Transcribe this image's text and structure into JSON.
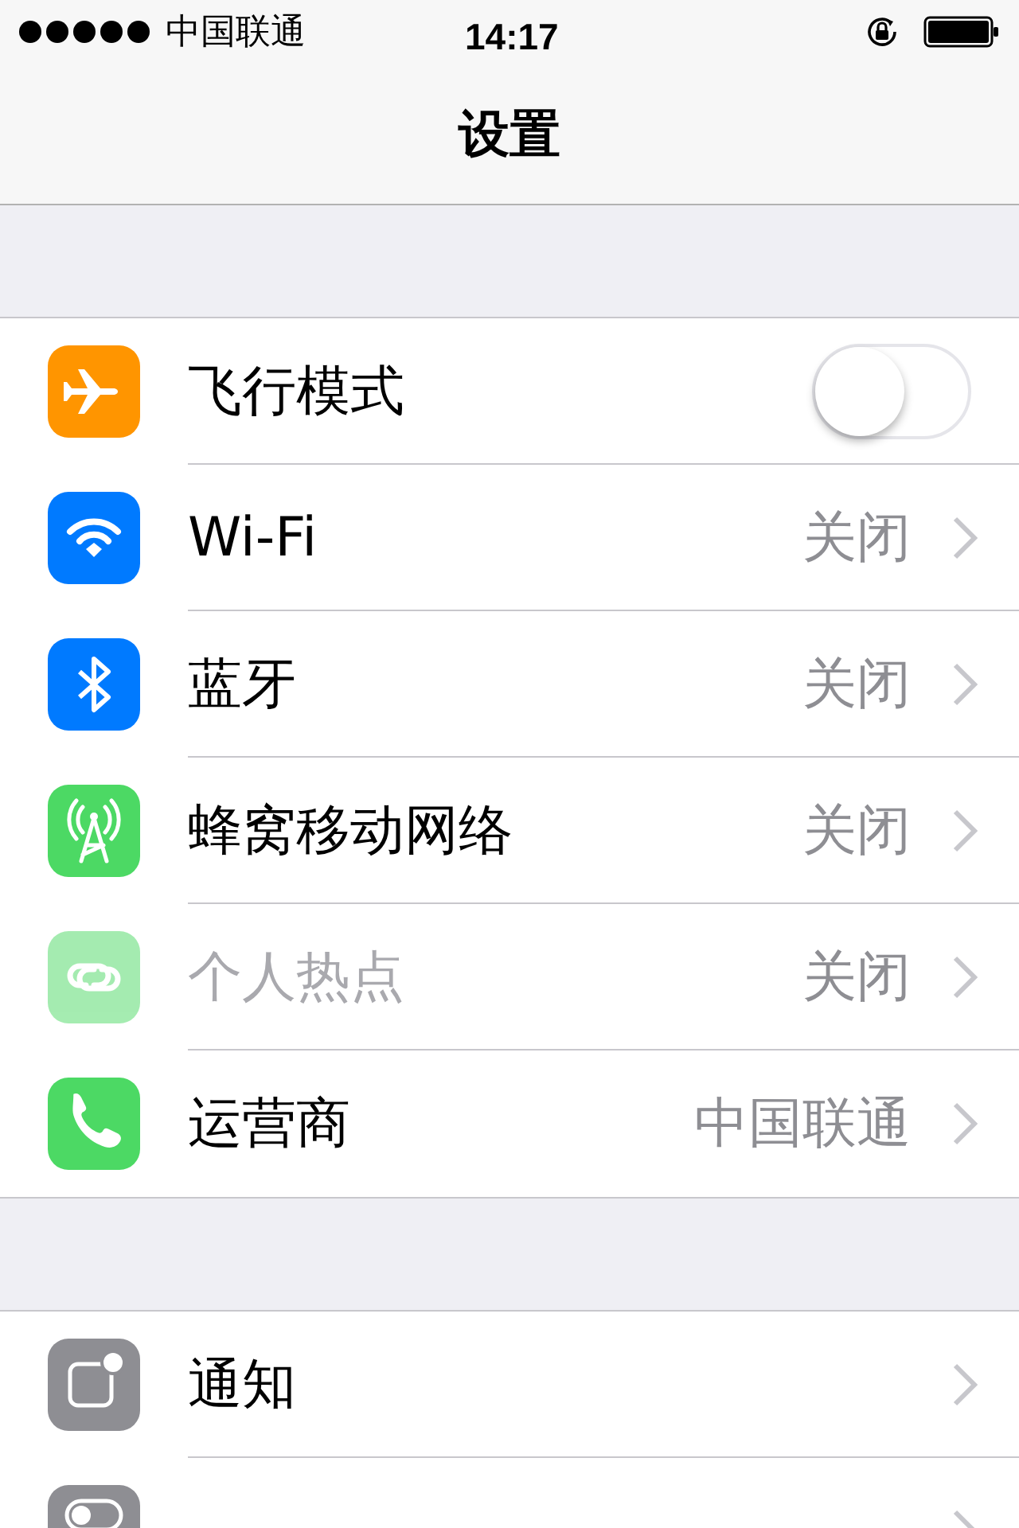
{
  "status_bar": {
    "carrier": "中国联通",
    "time": "14:17"
  },
  "nav_bar": {
    "title": "设置"
  },
  "groups": [
    {
      "rows": [
        {
          "kind": "toggle",
          "label": "飞行模式",
          "on": false,
          "disabled": false
        },
        {
          "kind": "link",
          "label": "Wi-Fi",
          "value": "关闭",
          "disabled": false
        },
        {
          "kind": "link",
          "label": "蓝牙",
          "value": "关闭",
          "disabled": false
        },
        {
          "kind": "link",
          "label": "蜂窝移动网络",
          "value": "关闭",
          "disabled": false
        },
        {
          "kind": "link",
          "label": "个人热点",
          "value": "关闭",
          "disabled": true
        },
        {
          "kind": "link",
          "label": "运营商",
          "value": "中国联通",
          "disabled": false
        }
      ]
    },
    {
      "rows": [
        {
          "kind": "link",
          "label": "通知",
          "disabled": false
        },
        {
          "kind": "link",
          "disabled": false
        }
      ]
    }
  ]
}
